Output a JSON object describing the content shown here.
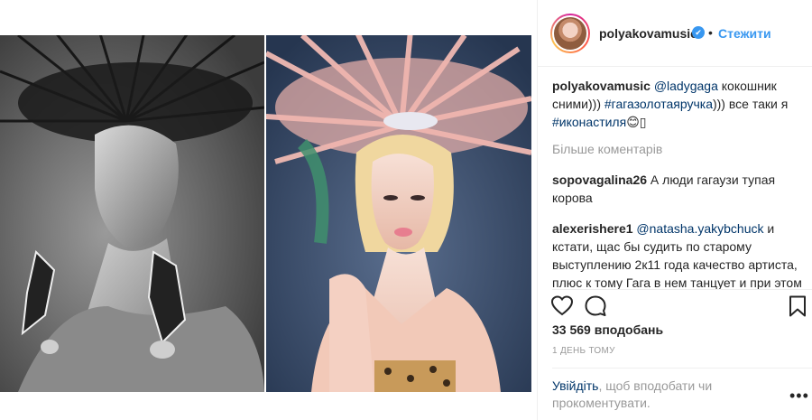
{
  "header": {
    "username": "polyakovamusic",
    "verified_icon": "✔",
    "separator": "•",
    "follow_label": "Стежити"
  },
  "comments": [
    {
      "user": "polyakovamusic",
      "mention": "@ladygaga",
      "text1": " кокошник сними))) ",
      "hashtag1": "#гагазолотаяручка",
      "text2": "))) все таки я ",
      "hashtag2": "#иконастиля",
      "emoji": "😊▯"
    },
    {
      "user": "sopovagalina26",
      "text": " А люди гагаузи тупая корова"
    },
    {
      "user": "alexerishere1",
      "mention": "@natasha.yakybchuck",
      "text": " и кстати, щас бы судить по старому выступлению 2к11 года качество артиста, плюс к тому Гага в нем танцует и при этом ей удается петь (вы сами попробуйте чисто ради интереса"
    }
  ],
  "more_comments": "Більше коментарів",
  "actions": {
    "like_icon": "heart-icon",
    "comment_icon": "comment-icon",
    "save_icon": "bookmark-icon"
  },
  "likes": "33 569 вподобань",
  "date": "1 ДЕНЬ ТОМУ",
  "login_prompt": {
    "link": "Увійдіть",
    "text": ", щоб вподобати чи прокоментувати."
  },
  "more_options": "•••",
  "colors": {
    "link_blue": "#3897f0",
    "mention": "#003569",
    "muted": "#999999",
    "text": "#262626"
  }
}
